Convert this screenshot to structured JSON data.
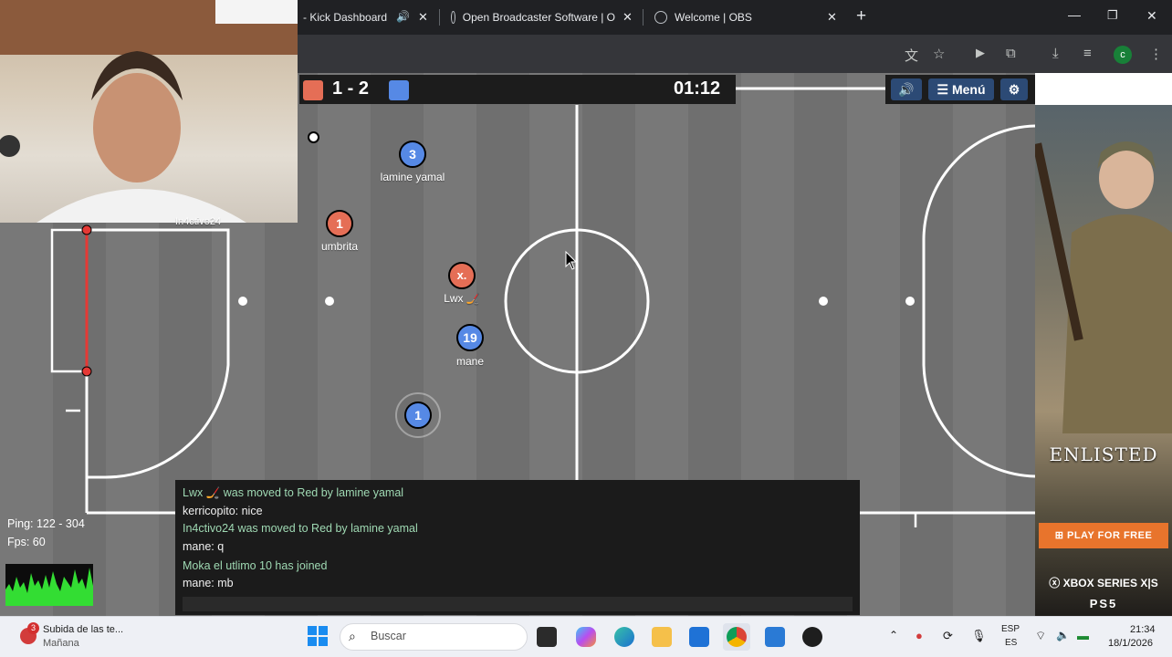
{
  "browser": {
    "tabs": [
      {
        "title": "- Kick Dashboard"
      },
      {
        "title": "Open Broadcaster Software | O"
      },
      {
        "title": "Welcome | OBS"
      }
    ],
    "close_glyph": "✕",
    "new_tab_glyph": "+",
    "profile_initial": "c"
  },
  "game": {
    "score_red": 1,
    "score_blue": 2,
    "score_text": "1 - 2",
    "timer": "01:12",
    "menu_label": "Menú",
    "players": [
      {
        "number": "3",
        "team": "blue",
        "name": "lamine yamal"
      },
      {
        "number": "1",
        "team": "red",
        "name": "umbrita"
      },
      {
        "number": "x.",
        "team": "red",
        "name": "Lwx 🏒"
      },
      {
        "number": "19",
        "team": "blue",
        "name": "mane"
      },
      {
        "number": "1",
        "team": "blue",
        "name": ""
      }
    ],
    "partial_name": "In4ctivo24",
    "colors": {
      "red": "#e56e56",
      "blue": "#5689e5",
      "field": "#737373"
    }
  },
  "chat": {
    "lines": [
      {
        "kind": "sys",
        "text": "Lwx 🏒  was moved to Red by lamine yamal"
      },
      {
        "kind": "msg",
        "text": "kerricopito: nice"
      },
      {
        "kind": "sys",
        "text": "In4ctivo24 was moved to Red by lamine yamal"
      },
      {
        "kind": "msg",
        "text": "mane: q"
      },
      {
        "kind": "sys",
        "text": "Moka el utlimo 10 has joined"
      },
      {
        "kind": "msg",
        "text": "mane: mb"
      }
    ]
  },
  "stats": {
    "ping": "Ping: 122 - 304",
    "fps": "Fps: 60"
  },
  "ad": {
    "title": "ENLISTED",
    "cta": "PLAY FOR FREE",
    "platform1": "XBOX SERIES X|S",
    "platform2": "PS5"
  },
  "taskbar": {
    "notif_badge": "3",
    "weather_title": "Subida de las te...",
    "weather_sub": "Mañana",
    "search_placeholder": "Buscar",
    "lang1": "ESP",
    "lang2": "ES",
    "time": "21:34",
    "date": "18/1/2026"
  }
}
